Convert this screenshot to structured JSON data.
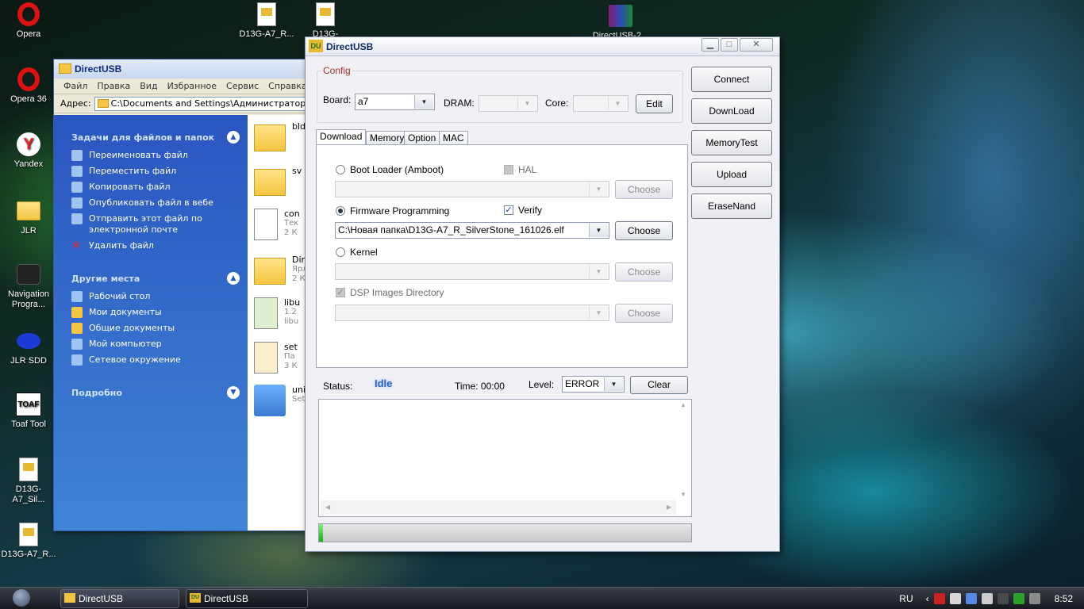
{
  "desktop": {
    "icons": [
      {
        "label": "Opera",
        "icon": "opera-icon"
      },
      {
        "label": "Opera 36",
        "icon": "opera-icon"
      },
      {
        "label": "Yandex",
        "icon": "yandex-icon"
      },
      {
        "label": "JLR",
        "icon": "folder-icon"
      },
      {
        "label": "Navigation Progra...",
        "icon": "bag-icon"
      },
      {
        "label": "JLR SDD",
        "icon": "jlr-sdd-icon"
      },
      {
        "label": "Toaf Tool",
        "icon": "toaf-icon"
      },
      {
        "label": "D13G-A7_Sil...",
        "icon": "file-icon"
      },
      {
        "label": "D13G-A7_R...",
        "icon": "file-icon"
      },
      {
        "label": "D13G-A7_R...",
        "icon": "file-icon"
      },
      {
        "label": "D13G-A7_Sil...",
        "icon": "file-icon"
      },
      {
        "label": "DirectUSB-2...",
        "icon": "winrar-icon"
      }
    ]
  },
  "explorer": {
    "title": "DirectUSB",
    "menu": [
      "Файл",
      "Правка",
      "Вид",
      "Избранное",
      "Сервис",
      "Справка"
    ],
    "address_label": "Адрес:",
    "address_value": "C:\\Documents and Settings\\Администратор\\Рабо",
    "tasks_header": "Задачи для файлов и папок",
    "tasks": [
      "Переименовать файл",
      "Переместить файл",
      "Копировать файл",
      "Опубликовать файл в вебе",
      "Отправить этот файл по электронной почте",
      "Удалить файл"
    ],
    "places_header": "Другие места",
    "places": [
      "Рабочий стол",
      "Мои документы",
      "Общие документы",
      "Мой компьютер",
      "Сетевое окружение"
    ],
    "details_header": "Подробно",
    "files": [
      {
        "name": "bld",
        "sub": ""
      },
      {
        "name": "sv",
        "sub": ""
      },
      {
        "name": "con",
        "sub": "Тек\n2 К"
      },
      {
        "name": "Dir",
        "sub": "Ярл\n2 К"
      },
      {
        "name": "libu",
        "sub": "1.2\nlibu"
      },
      {
        "name": "set",
        "sub": "Па\n3 К"
      },
      {
        "name": "uni",
        "sub": "Set"
      }
    ]
  },
  "dusb": {
    "title": "DirectUSB",
    "config_legend": "Config",
    "board_label": "Board:",
    "board_value": "a7",
    "dram_label": "DRAM:",
    "dram_value": "",
    "core_label": "Core:",
    "core_value": "",
    "edit_label": "Edit",
    "tabs": [
      "Download",
      "Memory",
      "Option",
      "MAC"
    ],
    "active_tab": "Download",
    "bootloader_label": "Boot Loader (Amboot)",
    "hal_label": "HAL",
    "firmware_label": "Firmware Programming",
    "verify_label": "Verify",
    "firmware_path": "C:\\Новая папка\\D13G-A7_R_SilverStone_161026.elf",
    "kernel_label": "Kernel",
    "dsp_label": "DSP Images Directory",
    "choose_label": "Choose",
    "side_buttons": [
      "Connect",
      "DownLoad",
      "MemoryTest",
      "Upload",
      "EraseNand"
    ],
    "status_label": "Status:",
    "status_value": "Idle",
    "time_label": "Time: 00:00",
    "level_label": "Level:",
    "level_value": "ERROR",
    "clear_label": "Clear",
    "progress": 0.01
  },
  "taskbar": {
    "buttons": [
      "DirectUSB",
      "DirectUSB"
    ],
    "lang": "RU",
    "clock": "8:52"
  }
}
